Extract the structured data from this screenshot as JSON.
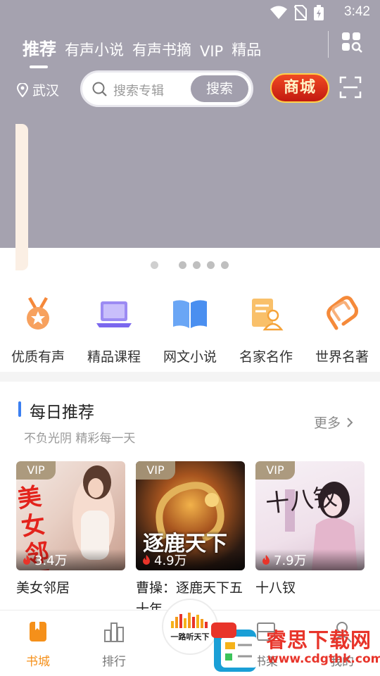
{
  "status_bar": {
    "time": "3:42"
  },
  "top_tabs": [
    {
      "label": "推荐",
      "active": true
    },
    {
      "label": "有声小说",
      "active": false
    },
    {
      "label": "有声书摘",
      "active": false
    },
    {
      "label": "VIP",
      "active": false
    },
    {
      "label": "精品",
      "active": false
    }
  ],
  "location": "武汉",
  "search": {
    "placeholder": "搜索专辑",
    "button": "搜索"
  },
  "mall_button": "商城",
  "banner": {
    "dot_count": 5,
    "active_index": 0
  },
  "categories": [
    {
      "label": "优质有声",
      "icon": "medal-icon",
      "color": "#f5883a"
    },
    {
      "label": "精品课程",
      "icon": "laptop-icon",
      "color": "#8a77f0"
    },
    {
      "label": "网文小说",
      "icon": "book-icon",
      "color": "#4a8ff0"
    },
    {
      "label": "名家名作",
      "icon": "author-doc-icon",
      "color": "#f5a33a"
    },
    {
      "label": "世界名著",
      "icon": "clip-icon",
      "color": "#f58a3a"
    }
  ],
  "daily": {
    "title": "每日推荐",
    "subtitle": "不负光阴 精彩每一天",
    "more": "更多"
  },
  "books": [
    {
      "title": "美女邻居",
      "plays": "3.4万",
      "vip": "VIP",
      "cover_text": "美女邻居"
    },
    {
      "title": "曹操：逐鹿天下五十年",
      "plays": "4.9万",
      "vip": "VIP",
      "cover_text": "逐鹿天下"
    },
    {
      "title": "十八钗",
      "plays": "7.9万",
      "vip": "VIP",
      "cover_text": "十八钗"
    }
  ],
  "bottom_nav": [
    {
      "label": "书城",
      "active": true
    },
    {
      "label": "排行",
      "active": false
    },
    {
      "label": "书架",
      "active": false
    },
    {
      "label": "我的",
      "active": false
    }
  ],
  "center_button": "一路听天下",
  "watermark": {
    "name": "睿思下载网",
    "url": "www.cdgthk.com"
  },
  "colors": {
    "hero_bg": "#a5a2af",
    "accent": "#f5901a",
    "blue_bar": "#3b7ff1"
  }
}
